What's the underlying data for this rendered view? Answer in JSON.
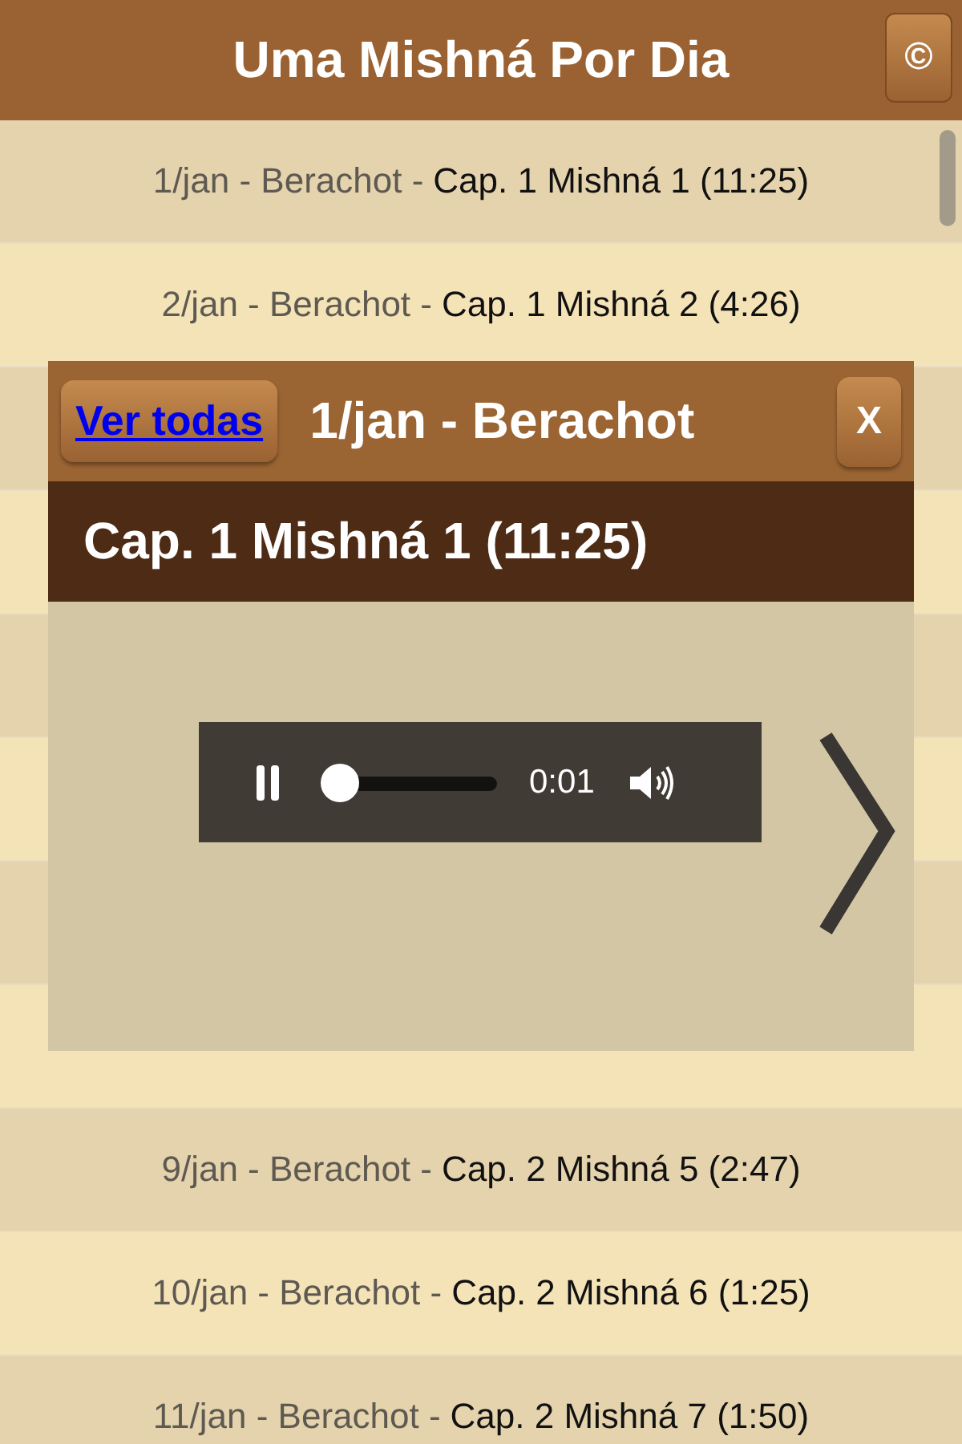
{
  "header": {
    "title": "Uma Mishná Por Dia",
    "button": "©"
  },
  "rows": [
    {
      "label": "1/jan - Berachot - ",
      "title": "Cap. 1 Mishná 1 (11:25)"
    },
    {
      "label": "2/jan - Berachot - ",
      "title": "Cap. 1 Mishná 2 (4:26)"
    },
    {},
    {},
    {},
    {},
    {},
    {},
    {
      "label": "9/jan - Berachot - ",
      "title": "Cap. 2 Mishná 5 (2:47)"
    },
    {
      "label": "10/jan - Berachot - ",
      "title": "Cap. 2 Mishná 6 (1:25)"
    },
    {
      "label": "11/jan - Berachot - ",
      "title": "Cap. 2 Mishná 7 (1:50)"
    }
  ],
  "popup": {
    "link": "Ver todas",
    "title": "1/jan - Berachot",
    "close": "X",
    "subtitle": "Cap. 1 Mishná 1 (11:25)",
    "player": {
      "playing": true,
      "level": 0.02,
      "time": "0:01"
    }
  }
}
